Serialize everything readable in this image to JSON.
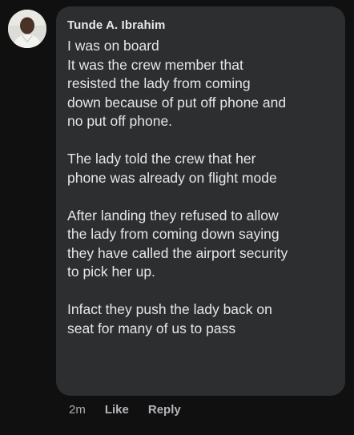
{
  "comment": {
    "author": "Tunde A. Ibrahim",
    "paragraphs": [
      [
        "I was on board",
        "It was the crew member that",
        "resisted the lady from coming",
        "down because of put off phone and",
        "no put off phone."
      ],
      [
        "The lady told the crew that her",
        "phone was already on flight mode"
      ],
      [
        "After landing they refused to allow",
        "the lady from coming down saying",
        "they have called the airport security",
        "to pick her up."
      ],
      [
        "Infact they push the lady back on",
        "seat for many of us to pass"
      ]
    ],
    "timestamp": "2m",
    "like_label": "Like",
    "reply_label": "Reply"
  },
  "avatar_icon": "user-avatar-icon",
  "colors": {
    "background": "#101011",
    "bubble": "#2d2e30",
    "text": "#e4e6ea",
    "meta": "#a8abaf"
  }
}
